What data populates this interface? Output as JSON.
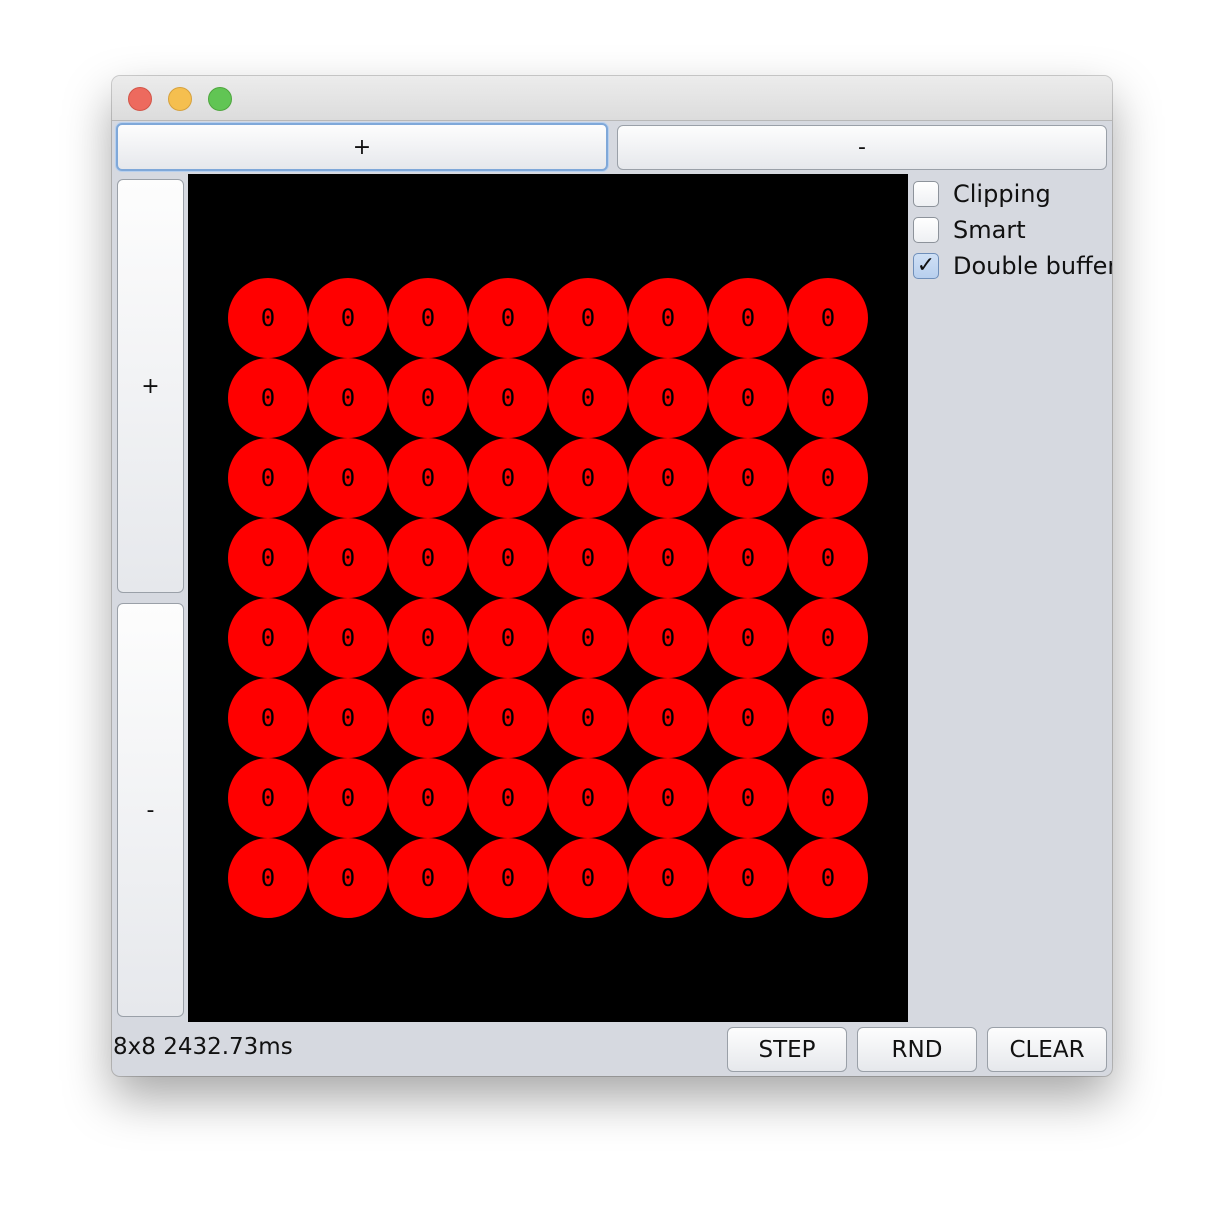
{
  "toolbar": {
    "top_plus": "+",
    "top_minus": "-",
    "left_plus": "+",
    "left_minus": "-"
  },
  "options": {
    "clipping": {
      "label": "Clipping",
      "checked": false
    },
    "smart": {
      "label": "Smart",
      "checked": false
    },
    "double_buffer": {
      "label": "Double buffer",
      "checked": true
    }
  },
  "grid": {
    "rows": 8,
    "cols": 8,
    "cell_value": "0",
    "cell_color": "#ff0000",
    "background": "#000000"
  },
  "status": {
    "text": "8x8 2432.73ms"
  },
  "buttons": {
    "step": "STEP",
    "rnd": "RND",
    "clear": "CLEAR"
  },
  "checkmark": "✓"
}
